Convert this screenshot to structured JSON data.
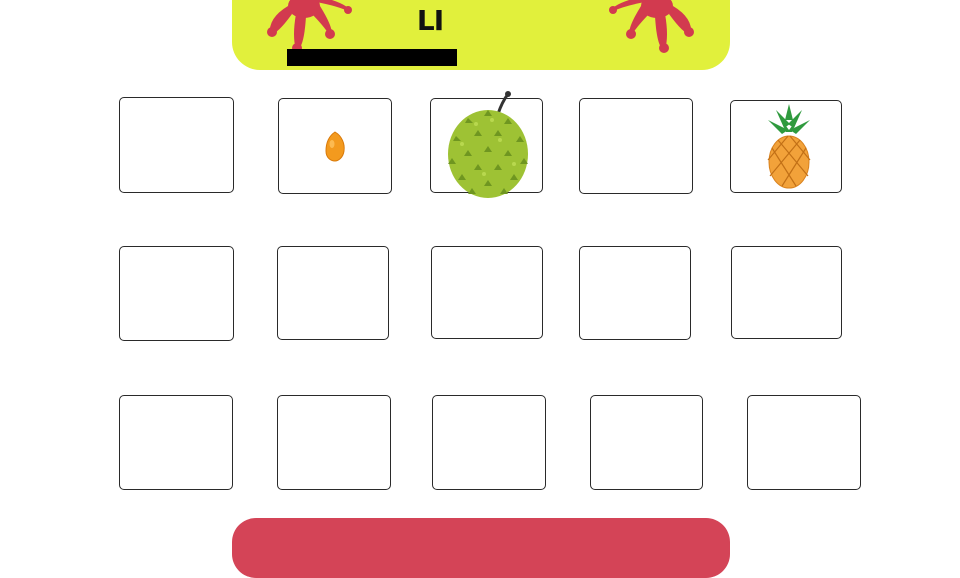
{
  "header": {
    "title": "LI",
    "accent_color": "#e1f03c",
    "splat_color": "#d23a4f"
  },
  "grid": {
    "rows": 3,
    "columns": 5,
    "cards": [
      {
        "row": 1,
        "col": 1,
        "content": ""
      },
      {
        "row": 1,
        "col": 2,
        "content": "orange-seed-icon"
      },
      {
        "row": 1,
        "col": 3,
        "content": "durian-icon"
      },
      {
        "row": 1,
        "col": 4,
        "content": ""
      },
      {
        "row": 1,
        "col": 5,
        "content": "pineapple-icon"
      },
      {
        "row": 2,
        "col": 1,
        "content": ""
      },
      {
        "row": 2,
        "col": 2,
        "content": ""
      },
      {
        "row": 2,
        "col": 3,
        "content": ""
      },
      {
        "row": 2,
        "col": 4,
        "content": ""
      },
      {
        "row": 2,
        "col": 5,
        "content": ""
      },
      {
        "row": 3,
        "col": 1,
        "content": ""
      },
      {
        "row": 3,
        "col": 2,
        "content": ""
      },
      {
        "row": 3,
        "col": 3,
        "content": ""
      },
      {
        "row": 3,
        "col": 4,
        "content": ""
      },
      {
        "row": 3,
        "col": 5,
        "content": ""
      }
    ]
  },
  "footer": {
    "bar_color": "#d44457"
  }
}
